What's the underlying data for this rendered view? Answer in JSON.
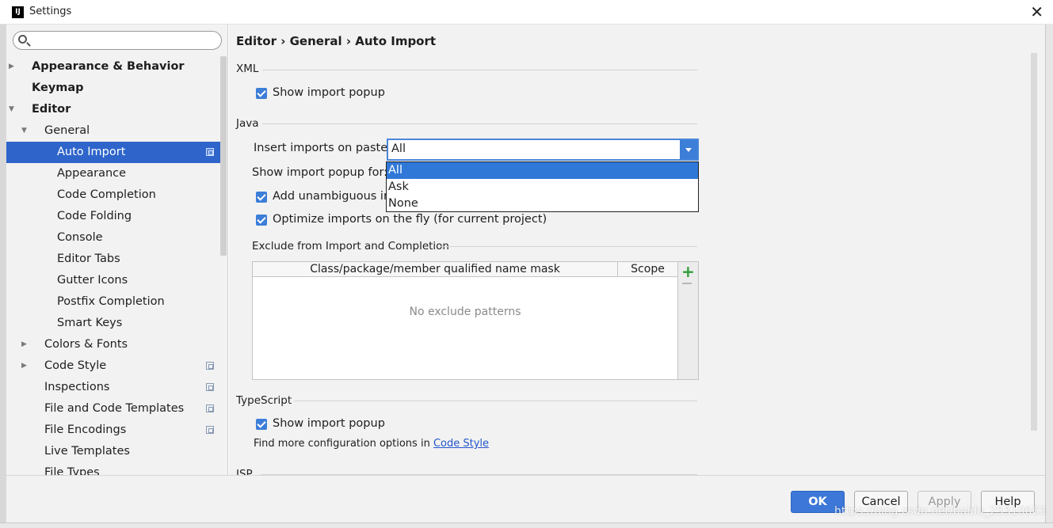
{
  "window": {
    "title": "Settings",
    "app_icon_text": "IJ",
    "close_glyph": "✕"
  },
  "sidebar": {
    "search": {
      "value": "",
      "placeholder": ""
    },
    "items": [
      {
        "label": "Appearance & Behavior",
        "bold": true,
        "level": 0,
        "arrow": "right"
      },
      {
        "label": "Keymap",
        "bold": true,
        "level": 0,
        "arrow": ""
      },
      {
        "label": "Editor",
        "bold": true,
        "level": 0,
        "arrow": "down"
      },
      {
        "label": "General",
        "bold": false,
        "level": 1,
        "arrow": "down"
      },
      {
        "label": "Auto Import",
        "bold": false,
        "level": 2,
        "arrow": "",
        "selected": true,
        "project_icon": true
      },
      {
        "label": "Appearance",
        "bold": false,
        "level": 2,
        "arrow": ""
      },
      {
        "label": "Code Completion",
        "bold": false,
        "level": 2,
        "arrow": ""
      },
      {
        "label": "Code Folding",
        "bold": false,
        "level": 2,
        "arrow": ""
      },
      {
        "label": "Console",
        "bold": false,
        "level": 2,
        "arrow": ""
      },
      {
        "label": "Editor Tabs",
        "bold": false,
        "level": 2,
        "arrow": ""
      },
      {
        "label": "Gutter Icons",
        "bold": false,
        "level": 2,
        "arrow": ""
      },
      {
        "label": "Postfix Completion",
        "bold": false,
        "level": 2,
        "arrow": ""
      },
      {
        "label": "Smart Keys",
        "bold": false,
        "level": 2,
        "arrow": ""
      },
      {
        "label": "Colors & Fonts",
        "bold": false,
        "level": 1,
        "arrow": "right"
      },
      {
        "label": "Code Style",
        "bold": false,
        "level": 1,
        "arrow": "right",
        "project_icon": true
      },
      {
        "label": "Inspections",
        "bold": false,
        "level": 1,
        "arrow": "",
        "project_icon": true
      },
      {
        "label": "File and Code Templates",
        "bold": false,
        "level": 1,
        "arrow": "",
        "project_icon": true
      },
      {
        "label": "File Encodings",
        "bold": false,
        "level": 1,
        "arrow": "",
        "project_icon": true
      },
      {
        "label": "Live Templates",
        "bold": false,
        "level": 1,
        "arrow": ""
      },
      {
        "label": "File Types",
        "bold": false,
        "level": 1,
        "arrow": ""
      }
    ]
  },
  "content": {
    "breadcrumb": "Editor › General › Auto Import",
    "xml": {
      "title": "XML",
      "show_import_popup": {
        "label": "Show import popup",
        "checked": true
      }
    },
    "java": {
      "title": "Java",
      "insert_imports_label": "Insert imports on paste:",
      "insert_imports_value": "All",
      "dropdown_options": [
        "All",
        "Ask",
        "None"
      ],
      "dropdown_selected": "All",
      "show_popup_for_label": "Show import popup for:",
      "add_unambiguous": {
        "label": "Add unambiguous im",
        "checked": true
      },
      "optimize_imports": {
        "label": "Optimize imports on the fly (for current project)",
        "checked": true
      }
    },
    "exclude": {
      "title": "Exclude from Import and Completion",
      "columns": [
        "Class/package/member qualified name mask",
        "Scope"
      ],
      "empty_text": "No exclude patterns",
      "add_glyph": "+"
    },
    "typescript": {
      "title": "TypeScript",
      "show_import_popup": {
        "label": "Show import popup",
        "checked": true
      },
      "find_more_text": "Find more configuration options in",
      "find_more_link": "Code Style"
    },
    "jsp": {
      "title": "JSP"
    }
  },
  "footer": {
    "ok_label": "OK",
    "cancel_label": "Cancel",
    "apply_label": "Apply",
    "help_label": "Help"
  },
  "watermark": "https://blog.csdn.net/baidu_25310663",
  "colors": {
    "selection": "#2f65ca",
    "accent": "#3c7ed8",
    "ok_button": "#3d78d8",
    "link": "#2255cc",
    "add_icon": "#2f9e3a"
  }
}
